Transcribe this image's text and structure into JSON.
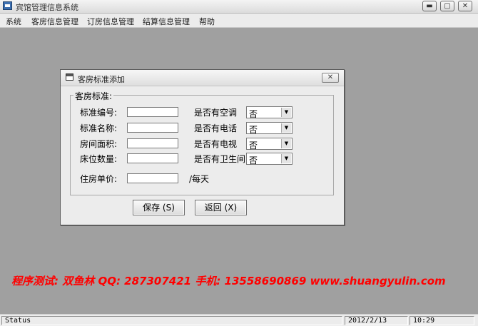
{
  "app": {
    "title": "宾馆管理信息系统",
    "buttons": {
      "minimize": "▬",
      "maximize": "▢",
      "close": "✕"
    }
  },
  "menu": [
    "系统",
    "客房信息管理",
    "订房信息管理",
    "结算信息管理",
    "帮助"
  ],
  "dialog": {
    "title": "客房标准添加",
    "close": "✕",
    "group_label": "客房标准:",
    "fields": {
      "std_no": {
        "label": "标准编号:",
        "value": ""
      },
      "std_name": {
        "label": "标准名称:",
        "value": ""
      },
      "area": {
        "label": "房间面积:",
        "value": ""
      },
      "beds": {
        "label": "床位数量:",
        "value": ""
      },
      "price": {
        "label": "住房单价:",
        "value": ""
      }
    },
    "price_unit": "/每天",
    "options": {
      "ac": {
        "label": "是否有空调",
        "value": "否"
      },
      "phone": {
        "label": "是否有电话",
        "value": "否"
      },
      "tv": {
        "label": "是否有电视",
        "value": "否"
      },
      "bath": {
        "label": "是否有卫生间",
        "value": "否"
      }
    },
    "save_label": "保存 (S)",
    "back_label": "返回 (X)"
  },
  "watermark": "程序测试: 双鱼林    QQ: 287307421    手机: 13558690869    www.shuangyulin.com",
  "status": {
    "text": "Status",
    "date": "2012/2/13",
    "time": "10:29"
  },
  "colors": {
    "desktop": "#a0a0a0",
    "watermark": "#ff0000"
  }
}
